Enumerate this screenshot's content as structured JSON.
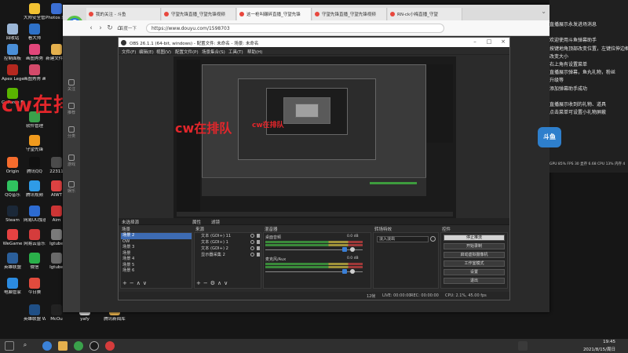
{
  "desktop": {
    "icons": [
      {
        "label": "大师安全管理",
        "color": "#f2c232"
      },
      {
        "label": "Photos 软件",
        "color": "#3b6fd4"
      },
      {
        "label": "回收站",
        "color": "#9bb6d6"
      },
      {
        "label": "看大师",
        "color": "#2e71c7"
      },
      {
        "label": "控制面板",
        "color": "#4a8fd8"
      },
      {
        "label": "画图秀秀",
        "color": "#e2467a"
      },
      {
        "label": "新建文件夹",
        "color": "#e5b04d"
      },
      {
        "label": "Apex Legends",
        "color": "#b5281f"
      },
      {
        "label": "画图秀秀 画图",
        "color": "#d44a6a"
      },
      {
        "label": "GeForce Experience",
        "color": "#59b400"
      },
      {
        "label": "软件管理",
        "color": "#3aa14b"
      },
      {
        "label": "守望先锋",
        "color": "#f09a1d"
      },
      {
        "label": "Origin",
        "color": "#f56c2d"
      },
      {
        "label": "腾讯QQ",
        "color": "#101010"
      },
      {
        "label": "22311",
        "color": "#4b4b4b"
      },
      {
        "label": "QQ音乐",
        "color": "#30c25f"
      },
      {
        "label": "腾讯视频",
        "color": "#2f9be7"
      },
      {
        "label": "AIWT",
        "color": "#dd4242"
      },
      {
        "label": "Steam",
        "color": "#1b2838"
      },
      {
        "label": "网易UU加速器",
        "color": "#2d6bd1"
      },
      {
        "label": "Aim",
        "color": "#cc3535"
      },
      {
        "label": "WeGame",
        "color": "#e54242"
      },
      {
        "label": "网易云音乐",
        "color": "#d53c3c"
      },
      {
        "label": "Igtube",
        "color": "#7a7a7a"
      },
      {
        "label": "英雄联盟",
        "color": "#2b5f9a"
      },
      {
        "label": "微信",
        "color": "#2ab04a"
      },
      {
        "label": "Igtube",
        "color": "#6a6a6a"
      },
      {
        "label": "电脑管家",
        "color": "#2b8be0"
      },
      {
        "label": "今日赛",
        "color": "#e24b3d"
      },
      {
        "label": "英雄联盟 WeGame版",
        "color": "#1f4f86"
      },
      {
        "label": "McOu",
        "color": "#222222"
      },
      {
        "label": "yafy",
        "color": "#d2d2d2"
      },
      {
        "label": "腾讯新闻库",
        "color": "#e5b04d"
      }
    ]
  },
  "overlay_text": {
    "big": "cw在排队",
    "medium": "cw在排队",
    "small": "cw在排队"
  },
  "browser": {
    "tabs": [
      "我的关注 - 斗鱼",
      "守望先锋直播_守望先锋视频",
      "这一枪叫碾碎直播_守望先锋",
      "守望先锋直播_守望先锋视频",
      "RN-ck小梅直播_守望"
    ],
    "logo_text": "e",
    "bookmark": "百度一下",
    "url": "https://www.douyu.com/1598703",
    "side_rail": [
      "关注",
      "推荐",
      "分类",
      "游戏",
      "娱乐"
    ]
  },
  "obs": {
    "title": "OBS 26.1.1 (64-bit, windows) - 配置文件: 未命名 - 场景: 未命名",
    "menu": [
      "文件(F)",
      "编辑(E)",
      "视图(V)",
      "配置文件(P)",
      "场景集合(S)",
      "工具(T)",
      "帮助(H)"
    ],
    "status_line": "未选择源",
    "status_btns": [
      "属性",
      "滤镜"
    ],
    "docks": {
      "scenes_title": "场景",
      "sources_title": "来源",
      "mixer_title": "混音器",
      "transitions_title": "转场特效",
      "controls_title": "控件"
    },
    "scenes": [
      "场景 2",
      "OW",
      "场景 3",
      "场景",
      "场景 4",
      "场景 5",
      "场景 6"
    ],
    "sources": [
      {
        "label": "文本 (GDI+) 11"
      },
      {
        "label": "文本 (GDI+) 1"
      },
      {
        "label": "文本 (GDI+) 2"
      },
      {
        "label": "显示器采集 2"
      }
    ],
    "mixer": [
      {
        "label": "桌面音频",
        "vol": "0.0 dB"
      },
      {
        "label": "麦克风/Aux",
        "vol": "0.0 dB"
      }
    ],
    "transition": "淡入淡出",
    "controls": [
      "停止推流",
      "开始录制",
      "启动虚拟摄像机",
      "工作室模式",
      "设置",
      "退出"
    ],
    "footer": {
      "live": "LIVE: 00:00:00",
      "rec": "REC: 00:00:00",
      "cpu": "CPU: 2.1%, 45.00 fps",
      "dropped": "12帧"
    }
  },
  "right_panel": {
    "lines": [
      "直播展示永发进场消息",
      "",
      "欢迎使用斗鱼弹幕助手",
      "按键地角顶部改变位置，左键拉伸边框",
      "改变大小",
      "右上角有设置菜单",
      "直播展示弹幕，鱼丸礼物，粉丝",
      "升级等",
      "添加弹幕助手成功",
      "",
      "直播展示收到的礼物、道具",
      "点击菜单可设置小礼物屏蔽"
    ],
    "stats": "GPU 85% FPS 30 显存 6.68 CPU 13% 内存 4",
    "mascot": "斗鱼"
  },
  "taskbar": {
    "time": "19:45",
    "date": "2021/8/15/周日"
  }
}
